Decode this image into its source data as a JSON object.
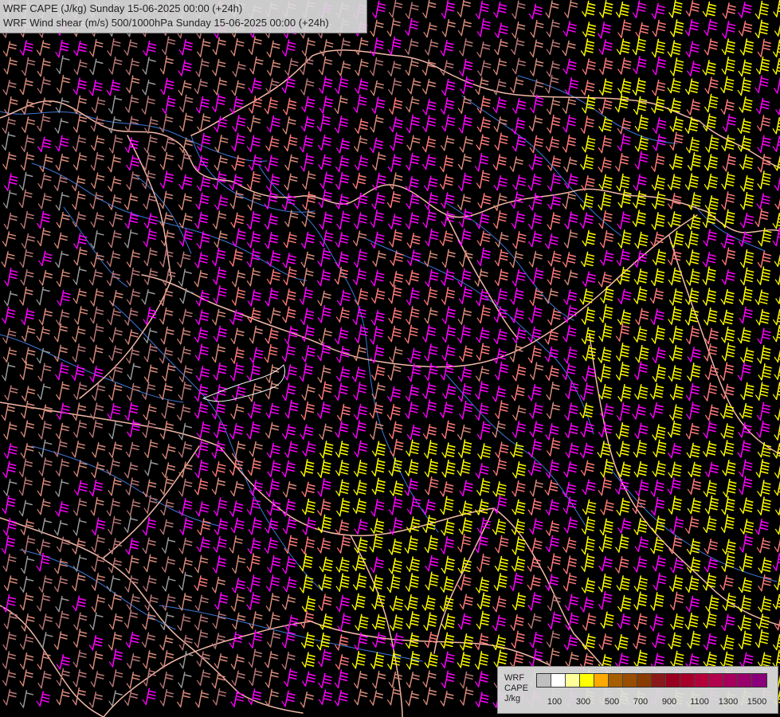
{
  "header": {
    "title_1": "WRF CAPE (J/kg) Sunday 15-06-2025 00:00 (+24h)",
    "title_2": "WRF Wind shear (m/s) 500/1000hPa Sunday 15-06-2025 00:00 (+24h)"
  },
  "legend": {
    "label_1": "WRF",
    "label_2": "CAPE",
    "label_3": "J/kg",
    "values": [
      "100",
      "300",
      "500",
      "700",
      "900",
      "1100",
      "1300",
      "1500"
    ],
    "colors": [
      "#bfbfbf",
      "#ffffff",
      "#ffff99",
      "#ffff00",
      "#ffaa00",
      "#a65f00",
      "#994d00",
      "#8a3b00",
      "#8a1a1a",
      "#99001f",
      "#a6002b",
      "#b3003b",
      "#b3004d",
      "#a6005c",
      "#99006b",
      "#8a007a"
    ]
  },
  "map": {
    "background": "#000000",
    "border_color": "#f2b8a8",
    "river_color": "#3d78d8",
    "barb_colors": [
      "#ffff00",
      "#ff00ff",
      "#ff7a7a",
      "#d98a7a",
      "#bb7777",
      "#999999"
    ]
  }
}
